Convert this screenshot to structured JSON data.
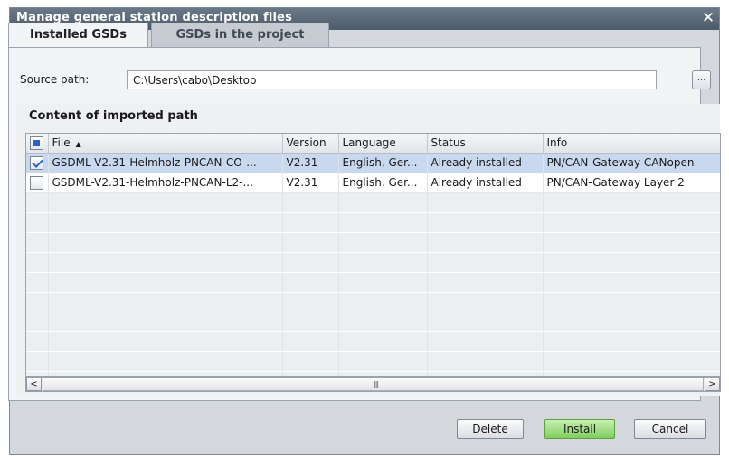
{
  "window": {
    "title": "Manage general station description files"
  },
  "tabs": [
    {
      "label": "Installed GSDs",
      "active": true
    },
    {
      "label": "GSDs in the project",
      "active": false
    }
  ],
  "source": {
    "label": "Source path:",
    "value": "C:\\Users\\cabo\\Desktop",
    "browse_label": "..."
  },
  "content": {
    "title": "Content of imported path",
    "columns": [
      "File",
      "Version",
      "Language",
      "Status",
      "Info"
    ],
    "sort_column": "File",
    "sort_direction": "ascending",
    "select_all": "partial",
    "rows": [
      {
        "checked": true,
        "selected": true,
        "file": "GSDML-V2.31-Helmholz-PNCAN-CO-...",
        "version": "V2.31",
        "language": "English, Ger...",
        "status": "Already installed",
        "info": "PN/CAN-Gateway CANopen"
      },
      {
        "checked": false,
        "selected": false,
        "file": "GSDML-V2.31-Helmholz-PNCAN-L2-...",
        "version": "V2.31",
        "language": "English, Ger...",
        "status": "Already installed",
        "info": "PN/CAN-Gateway Layer 2"
      }
    ]
  },
  "buttons": {
    "delete": "Delete",
    "install": "Install",
    "cancel": "Cancel"
  },
  "colors": {
    "title_bar": "#55626f",
    "install_button": "#7fcf5d",
    "selection": "#c8d8ef",
    "check": "#2b64c2"
  }
}
